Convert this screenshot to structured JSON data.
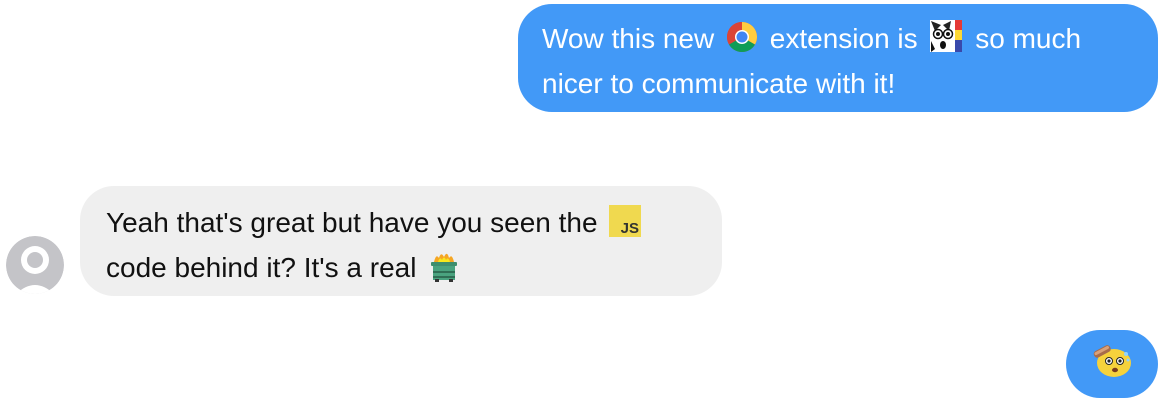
{
  "conversation": {
    "messages": [
      {
        "sender": "me",
        "lines": [
          {
            "text_before": "Wow this new",
            "icon": "chrome-logo-icon",
            "text_middle": "extension is",
            "icon2": "manga-face-emoji",
            "text_after": "so much"
          },
          {
            "text": "nicer to communicate with it!"
          }
        ]
      },
      {
        "sender": "other",
        "lines": [
          {
            "text_before": "Yeah that's great but have you seen the",
            "icon": "javascript-logo-icon"
          },
          {
            "text_before": "code behind it? It's a real",
            "icon": "dumpster-fire-emoji"
          }
        ]
      },
      {
        "sender": "me",
        "icon": "surprised-face-emoji"
      }
    ]
  },
  "colors": {
    "sent_bubble": "#4299f7",
    "received_bubble": "#efefef",
    "sent_text": "#ffffff",
    "received_text": "#111111",
    "avatar": "#c4c4c8"
  },
  "icons": {
    "javascript_logo_text": "JS"
  }
}
